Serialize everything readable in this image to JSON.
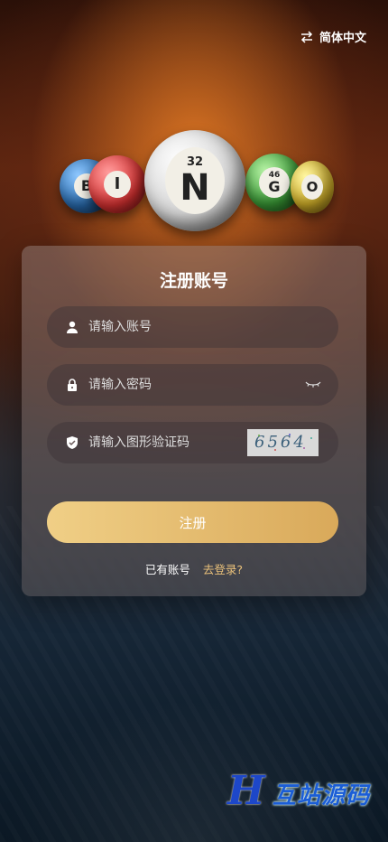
{
  "language": {
    "label": "简体中文",
    "icon": "swap-arrows-icon"
  },
  "balls": [
    {
      "letter": "B",
      "number": ""
    },
    {
      "letter": "I",
      "number": ""
    },
    {
      "letter": "N",
      "number": "32"
    },
    {
      "letter": "G",
      "number": "46"
    },
    {
      "letter": "O",
      "number": ""
    }
  ],
  "card": {
    "title": "注册账号",
    "fields": {
      "account": {
        "placeholder": "请输入账号",
        "icon": "user-icon"
      },
      "password": {
        "placeholder": "请输入密码",
        "icon": "lock-icon",
        "toggle_icon": "eye-closed-icon"
      },
      "captcha": {
        "placeholder": "请输入图形验证码",
        "icon": "shield-icon",
        "code": "6564"
      }
    },
    "submit_label": "注册",
    "have_account": "已有账号",
    "login_link": "去登录?"
  },
  "watermark": {
    "mark": "H",
    "text": "互站源码"
  },
  "colors": {
    "accent": "#e9c07a",
    "button_start": "#f0cf86",
    "button_end": "#d9a95a"
  }
}
